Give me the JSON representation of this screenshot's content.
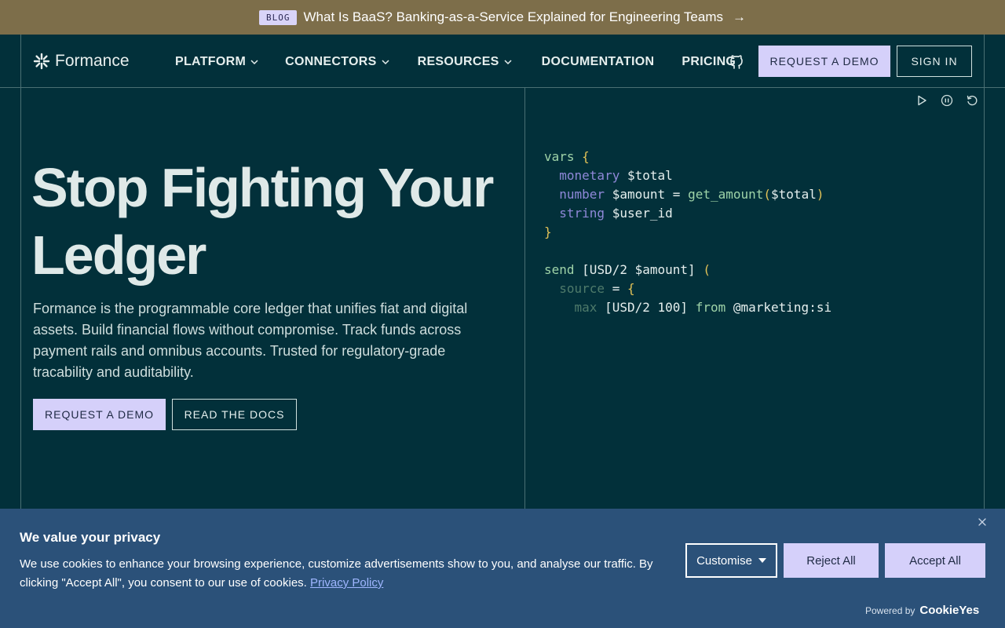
{
  "announcement": {
    "badge": "BLOG",
    "text": "What Is BaaS? Banking-as-a-Service Explained for Engineering Teams",
    "arrow": "→"
  },
  "nav": {
    "logo": "Formance",
    "menu": [
      {
        "label": "PLATFORM",
        "dropdown": true
      },
      {
        "label": "CONNECTORS",
        "dropdown": true
      },
      {
        "label": "RESOURCES",
        "dropdown": true
      },
      {
        "label": "DOCUMENTATION",
        "dropdown": false
      },
      {
        "label": "PRICING",
        "dropdown": false
      }
    ],
    "github_icon": "github-icon",
    "request_demo": "REQUEST A DEMO",
    "sign_in": "SIGN IN"
  },
  "hero": {
    "title_line1": "Stop Fighting Your",
    "title_line2": "Ledger",
    "description": "Formance is the programmable core ledger that unifies fiat and digital assets. Build financial flows without compromise. Track funds across payment rails and omnibus accounts. Trusted for regulatory-grade tracability and auditability.",
    "cta_primary": "REQUEST A DEMO",
    "cta_secondary": "READ THE DOCS"
  },
  "code_panel": {
    "controls": [
      "play-icon",
      "pause-icon",
      "restart-icon"
    ],
    "tokens": {
      "vars": "vars",
      "open_brace": "{",
      "close_brace": "}",
      "monetary": "monetary",
      "total_var": "$total",
      "number": "number",
      "amount_var": "$amount",
      "eq": "=",
      "get_amount": "get_amount",
      "open_paren": "(",
      "close_paren": ")",
      "string": "string",
      "user_id_var": "$user_id",
      "send": "send",
      "usd2": "[USD/2",
      "close_bracket": "]",
      "source": "source",
      "max": "max",
      "usd2_100": "[USD/2 100]",
      "from": "from",
      "account": "@marketing:si"
    }
  },
  "cookie_banner": {
    "title": "We value your privacy",
    "body": "We use cookies to enhance your browsing experience, customize advertisements show to you, and analyse our traffic. By clicking \"Accept All\", you consent to our use of cookies.",
    "policy_link": "Privacy Policy",
    "customise": "Customise",
    "reject": "Reject All",
    "accept": "Accept All",
    "powered_by": "Powered by",
    "powered_brand": "CookieYes"
  },
  "colors": {
    "background": "#02303a",
    "announcement_bg": "#7d6e4a",
    "accent": "#d5d0fa",
    "cookie_bg": "#2b5179"
  }
}
